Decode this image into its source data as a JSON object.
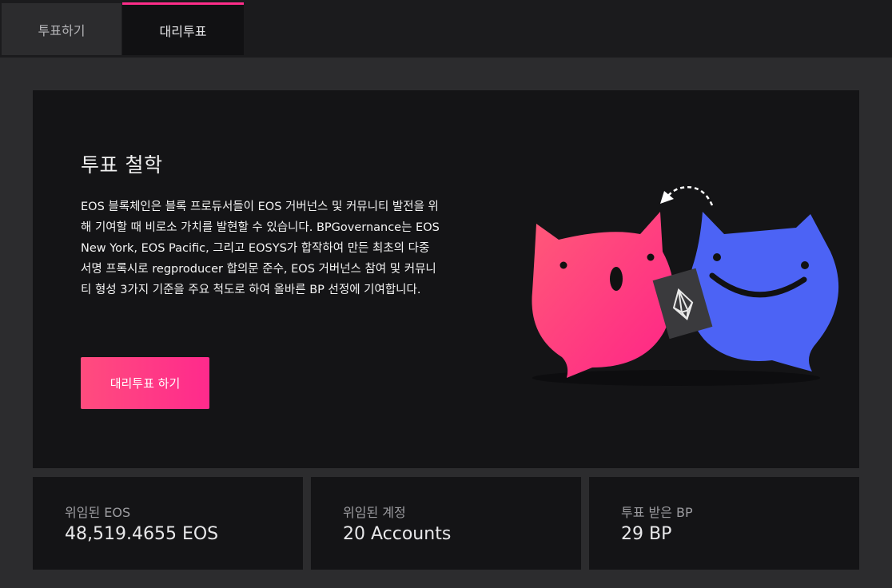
{
  "tabs": [
    {
      "label": "투표하기",
      "active": false
    },
    {
      "label": "대리투표",
      "active": true
    }
  ],
  "hero": {
    "title": "투표 철학",
    "description": "EOS 블록체인은 블록 프로듀서들이 EOS 거버넌스 및 커뮤니티 발전을 위해 기여할 때 비로소 가치를 발현할 수 있습니다. BPGovernance는 EOS New York, EOS Pacific, 그리고 EOSYS가 합작하여 만든 최초의 다중 서명 프록시로 regproducer 합의문 준수, EOS 거버넌스 참여 및 커뮤니티 형성 3가지 기준을 주요 척도로 하여 올바른 BP 선정에 기여합니다.",
    "cta_label": "대리투표 하기"
  },
  "stats": [
    {
      "label": "위임된 EOS",
      "value": "48,519.4655 EOS"
    },
    {
      "label": "위임된 계정",
      "value": "20 Accounts"
    },
    {
      "label": "투표 받은 BP",
      "value": "29 BP"
    }
  ],
  "colors": {
    "accent": "#ff2d8a",
    "pink_character": "#ff3b7a",
    "blue_character": "#4c63f5",
    "tag": "#3a3a3d"
  },
  "icons": [
    "eos-logo-icon",
    "curved-arrow-icon"
  ]
}
